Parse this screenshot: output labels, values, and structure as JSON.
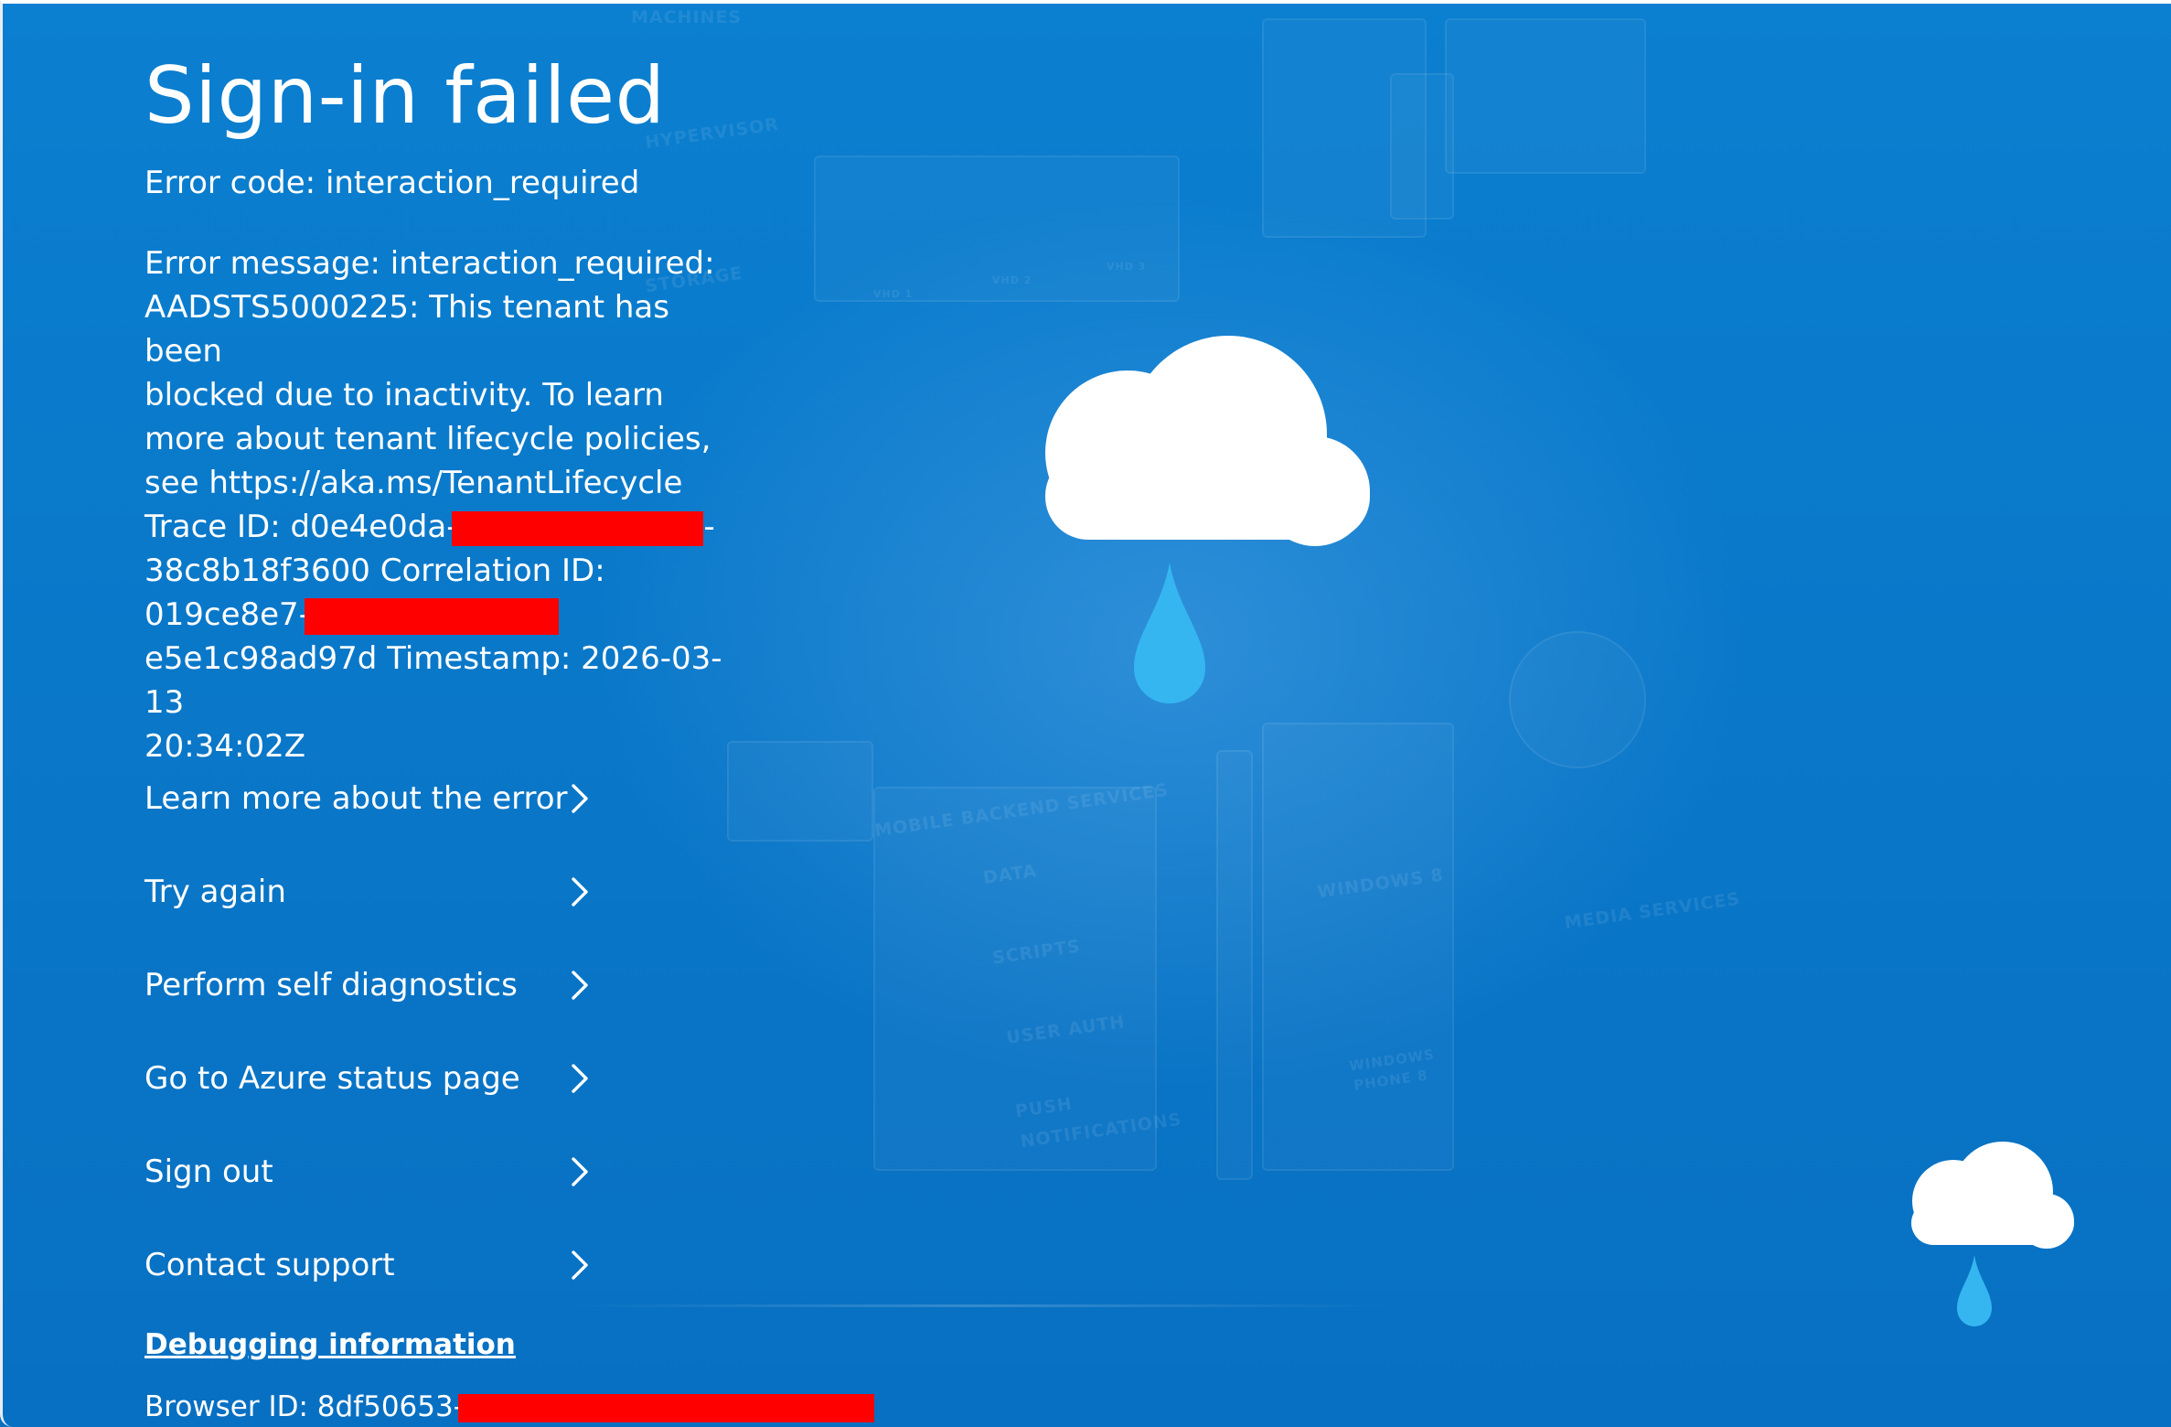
{
  "page": {
    "title": "Sign-in failed",
    "error_code": "Error code: interaction_required",
    "error_message_lines": [
      "Error message: interaction_required:",
      "AADSTS5000225: This tenant has been",
      "blocked due to inactivity. To learn",
      "more about tenant lifecycle policies,",
      "see https://aka.ms/TenantLifecycle"
    ],
    "trace_id_prefix": "Trace ID: d0e4e0da-",
    "trace_id_suffix": "-",
    "trace_line_2": "38c8b18f3600 Correlation ID:",
    "correlation_id_prefix": "019ce8e7-",
    "correlation_line_2": "e5e1c98ad97d Timestamp: 2026-03-13",
    "timestamp_line_2": "20:34:02Z"
  },
  "actions": [
    {
      "label": "Learn more about the error",
      "icon": "chevron-right-icon"
    },
    {
      "label": "Try again",
      "icon": "chevron-right-icon"
    },
    {
      "label": "Perform self diagnostics",
      "icon": "chevron-right-icon"
    },
    {
      "label": "Go to Azure status page",
      "icon": "chevron-right-icon"
    },
    {
      "label": "Sign out",
      "icon": "chevron-right-icon"
    },
    {
      "label": "Contact support",
      "icon": "chevron-right-icon"
    }
  ],
  "debug": {
    "link_label": "Debugging information",
    "browser_id_prefix": "Browser ID: 8df50653-"
  },
  "background_labels": {
    "machines": "MACHINES",
    "hypervisor": "HYPERVISOR",
    "storage": "STORAGE",
    "vhd1": "VHD 1",
    "vhd2": "VHD 2",
    "vhd3": "VHD 3",
    "mobile_backend": "MOBILE BACKEND SERVICES",
    "data": "DATA",
    "scripts": "SCRIPTS",
    "user_auth": "USER AUTH",
    "push_1": "PUSH",
    "push_2": "NOTIFICATIONS",
    "windows8": "WINDOWS 8",
    "windows_phone_1": "WINDOWS",
    "windows_phone_2": "PHONE 8",
    "media": "MEDIA SERVICES"
  },
  "colors": {
    "background": "#0a78c9",
    "redaction": "#ff0000",
    "drop": "#35b6f0",
    "cloud": "#ffffff"
  },
  "icons": {
    "big_cloud": "cloud-rain-icon",
    "small_cloud": "cloud-rain-icon"
  }
}
